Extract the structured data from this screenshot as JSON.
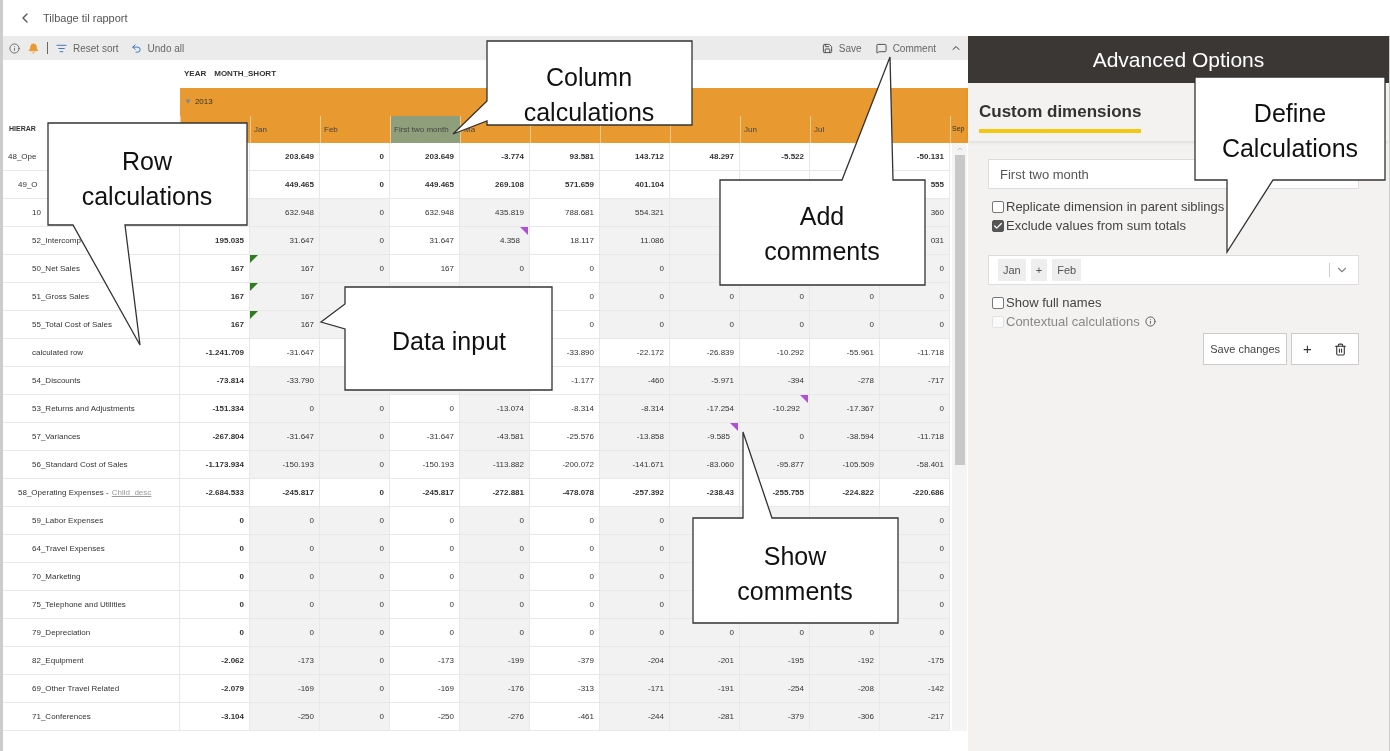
{
  "back_link": "Tilbage til rapport",
  "toolbar": {
    "left": [
      {
        "label": "Reset sort"
      },
      {
        "label": "Undo all"
      }
    ],
    "right": [
      {
        "label": "Save"
      },
      {
        "label": "Comment"
      }
    ]
  },
  "field_labels": [
    "YEAR",
    "MONTH_SHORT"
  ],
  "year": {
    "toggle": "▼",
    "label": "2013",
    "expanded": true
  },
  "table": {
    "hierarchy_header": "HIERAR",
    "columns": [
      null,
      "Jan",
      "Feb",
      "First two month",
      "Ma",
      null,
      null,
      null,
      "Jun",
      "Jul",
      null
    ],
    "extra_column": "Sep",
    "rows": [
      {
        "label": "48_Ope",
        "kind": "group",
        "cells": [
          null,
          "203.649",
          "0",
          "203.649",
          "-3.774",
          "93.581",
          "143.712",
          "48.297",
          "-5.522",
          null,
          "-50.131"
        ],
        "children": [
          {
            "label": "49_O",
            "kind": "group",
            "cells": [
              null,
              "449.465",
              "0",
              "449.465",
              "269.108",
              "571.659",
              "401.104",
              null,
              null,
              null,
              "555"
            ],
            "children": [
              {
                "label": "10",
                "kind": "leaf",
                "cells": [
                  null,
                  "632.948",
                  "0",
                  "632.948",
                  "435.819",
                  "788.681",
                  "554.321",
                  null,
                  null,
                  null,
                  "360"
                ]
              },
              {
                "label": "52_Intercomp",
                "kind": "leaf",
                "cells": [
                  "195.035",
                  "31.647",
                  "0",
                  "31.647",
                  {
                    "value": "4.358",
                    "kind": "comment"
                  },
                  "18.117",
                  "11.086",
                  null,
                  null,
                  null,
                  "031"
                ]
              },
              {
                "label": "50_Net Sales",
                "kind": "leaf",
                "cells": [
                  "167",
                  {
                    "value": "167",
                    "kind": "input"
                  },
                  "0",
                  "167",
                  "0",
                  "0",
                  "0",
                  null,
                  null,
                  null,
                  "0"
                ]
              },
              {
                "label": "51_Gross Sales",
                "kind": "leaf",
                "cells": [
                  "167",
                  {
                    "value": "167",
                    "kind": "input"
                  },
                  null,
                  null,
                  null,
                  "0",
                  "0",
                  "0",
                  "0",
                  "0",
                  "0"
                ]
              },
              {
                "label": "55_Total Cost of Sales",
                "kind": "leaf",
                "cells": [
                  "167",
                  {
                    "value": "167",
                    "kind": "input"
                  },
                  null,
                  null,
                  null,
                  "0",
                  "0",
                  "0",
                  "0",
                  "0",
                  "0"
                ]
              },
              {
                "label": "calculated row",
                "kind": "calc",
                "cells": [
                  "-1.241.709",
                  "-31.647",
                  null,
                  null,
                  null,
                  "-33.890",
                  "-22.172",
                  "-26.839",
                  "-10.292",
                  "-55.961",
                  "-11.718"
                ]
              },
              {
                "label": "54_Discounts",
                "kind": "leaf",
                "cells": [
                  "-73.814",
                  "-33.790",
                  null,
                  null,
                  null,
                  "-1.177",
                  "-460",
                  "-5.971",
                  "-394",
                  "-278",
                  "-717"
                ]
              },
              {
                "label": "53_Returns and Adjustments",
                "kind": "leaf",
                "cells": [
                  "-151.334",
                  "0",
                  "0",
                  "0",
                  "-13.074",
                  "-8.314",
                  "-8.314",
                  "-17.254",
                  {
                    "value": "-10.292",
                    "kind": "comment"
                  },
                  "-17.367",
                  "0"
                ]
              },
              {
                "label": "57_Variances",
                "kind": "leaf",
                "cells": [
                  "-267.804",
                  "-31.647",
                  "0",
                  "-31.647",
                  "-43.581",
                  "-25.576",
                  "-13.858",
                  {
                    "value": "-9.585",
                    "kind": "comment"
                  },
                  "0",
                  "-38.594",
                  "-11.718"
                ]
              },
              {
                "label": "56_Standard Cost of Sales",
                "kind": "leaf",
                "cells": [
                  "-1.173.934",
                  "-150.193",
                  "0",
                  "-150.193",
                  "-113.882",
                  "-200.072",
                  "-141.671",
                  "-83.060",
                  "-95.877",
                  "-105.509",
                  "-58.401"
                ]
              }
            ]
          },
          {
            "label": "58_Operating Expenses -",
            "link": "Child_desc",
            "kind": "group",
            "cells": [
              "-2.684.533",
              "-245.817",
              "0",
              "-245.817",
              "-272.881",
              "-478.078",
              "-257.392",
              "-238.43",
              "-255.755",
              "-224.822",
              "-220.686"
            ],
            "children": [
              {
                "label": "59_Labor Expenses",
                "kind": "leaf",
                "cells": [
                  "0",
                  "0",
                  "0",
                  "0",
                  "0",
                  "0",
                  "0",
                  null,
                  null,
                  null,
                  "0"
                ]
              },
              {
                "label": "64_Travel Expenses",
                "kind": "leaf",
                "cells": [
                  "0",
                  "0",
                  "0",
                  "0",
                  "0",
                  "0",
                  "0",
                  null,
                  null,
                  null,
                  "0"
                ]
              },
              {
                "label": "70_Marketing",
                "kind": "leaf",
                "cells": [
                  "0",
                  "0",
                  "0",
                  "0",
                  "0",
                  "0",
                  "0",
                  null,
                  null,
                  null,
                  "0"
                ]
              },
              {
                "label": "75_Telephone and Utilities",
                "kind": "leaf",
                "cells": [
                  "0",
                  "0",
                  "0",
                  "0",
                  "0",
                  "0",
                  "0",
                  null,
                  null,
                  null,
                  "0"
                ]
              },
              {
                "label": "79_Depreciation",
                "kind": "leaf",
                "cells": [
                  "0",
                  "0",
                  "0",
                  "0",
                  "0",
                  "0",
                  "0",
                  "0",
                  "0",
                  "0",
                  "0"
                ]
              },
              {
                "label": "82_Equipment",
                "kind": "leaf",
                "cells": [
                  "-2.062",
                  "-173",
                  "0",
                  "-173",
                  "-199",
                  "-379",
                  "-204",
                  "-201",
                  "-195",
                  "-192",
                  "-175"
                ]
              },
              {
                "label": "69_Other Travel Related",
                "kind": "leaf",
                "cells": [
                  "-2.079",
                  "-169",
                  "0",
                  "-169",
                  "-176",
                  "-313",
                  "-171",
                  "-191",
                  "-254",
                  "-208",
                  "-142"
                ]
              },
              {
                "label": "71_Conferences",
                "kind": "leaf",
                "cells": [
                  "-3.104",
                  "-250",
                  "0",
                  "-250",
                  "-276",
                  "-461",
                  "-244",
                  "-281",
                  "-379",
                  "-306",
                  "-217"
                ]
              }
            ]
          }
        ]
      }
    ]
  },
  "panel": {
    "title": "Advanced Options",
    "tab": {
      "label": "Custom dimensions",
      "selected": true
    },
    "name_field": {
      "value": "First two month"
    },
    "options": [
      {
        "label": "Replicate dimension in parent siblings",
        "checked": false
      },
      {
        "label": "Exclude values from sum totals",
        "checked": true
      }
    ],
    "formula_tokens": [
      "Jan",
      "+",
      "Feb"
    ],
    "display_options": [
      {
        "label": "Show full names",
        "checked": false,
        "disabled": false,
        "info": false
      },
      {
        "label": "Contextual calculations",
        "checked": false,
        "disabled": true,
        "info": true
      }
    ],
    "buttons": [
      {
        "kind": "text",
        "label": "Save changes"
      },
      {
        "kind": "add",
        "label": "+"
      }
    ]
  },
  "callouts": [
    {
      "lines": [
        "Row",
        "calculations"
      ]
    },
    {
      "lines": [
        "Column",
        "calculations"
      ]
    },
    {
      "lines": [
        "Add",
        "comments"
      ]
    },
    {
      "lines": [
        "Data input"
      ]
    },
    {
      "lines": [
        "Show",
        "comments"
      ]
    },
    {
      "lines": [
        "Define",
        "Calculations"
      ]
    }
  ]
}
